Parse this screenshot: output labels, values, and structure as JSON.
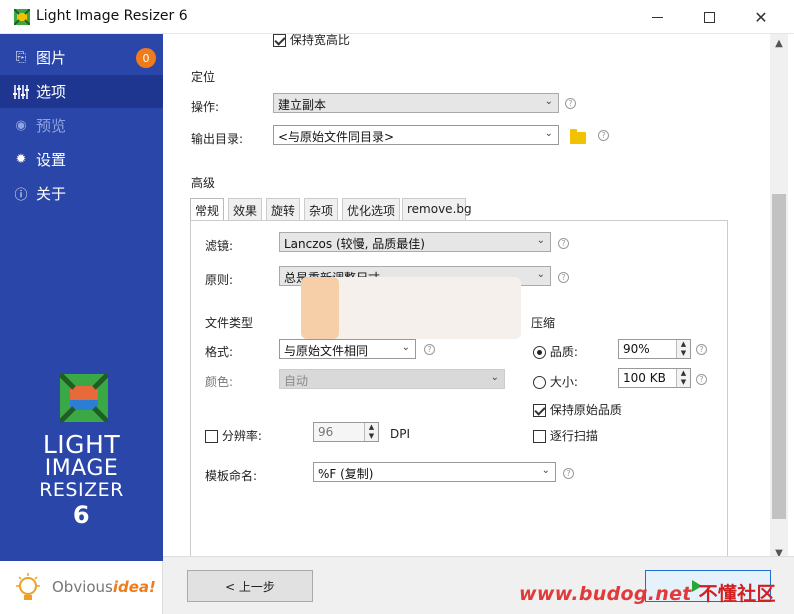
{
  "window": {
    "title": "Light Image Resizer 6"
  },
  "sidebar": {
    "items": [
      {
        "label": "图片",
        "icon": "images-icon",
        "badge": "0"
      },
      {
        "label": "选项",
        "icon": "sliders-icon"
      },
      {
        "label": "预览",
        "icon": "eye-icon"
      },
      {
        "label": "设置",
        "icon": "gear-icon"
      },
      {
        "label": "关于",
        "icon": "info-icon"
      }
    ],
    "logo": {
      "line1": "LIGHT",
      "line2": "IMAGE",
      "line3": "RESIZER",
      "line4": "6"
    },
    "brand": {
      "prefix": "Obvious",
      "suffix": "idea!"
    }
  },
  "options": {
    "keep_ratio_label": "保持宽高比",
    "location_title": "定位",
    "operation_label": "操作:",
    "operation_value": "建立副本",
    "output_dir_label": "输出目录:",
    "output_dir_value": "<与原始文件同目录>",
    "advanced_title": "高级",
    "tabs": [
      "常规",
      "效果",
      "旋转",
      "杂项",
      "优化选项",
      "remove.bg"
    ],
    "filter_label": "滤镜:",
    "filter_value": "Lanczos (较慢, 品质最佳)",
    "rule_label": "原则:",
    "rule_value": "总是重新调整尺寸",
    "file_type_title": "文件类型",
    "compress_title": "压缩",
    "format_label": "格式:",
    "format_value": "与原始文件相同",
    "color_label": "颜色:",
    "color_value": "自动",
    "quality_label": "品质:",
    "quality_value": "90%",
    "size_label": "大小:",
    "size_value": "100 KB",
    "keep_quality_label": "保持原始品质",
    "progressive_label": "逐行扫描",
    "resolution_label": "分辨率:",
    "resolution_value": "96",
    "dpi_label": "DPI",
    "template_label": "模板命名:",
    "template_value": "%F (复制)"
  },
  "footer": {
    "prev_label": "< 上一步",
    "watermark_en": "www.budog.net",
    "watermark_cn": "不懂社区"
  },
  "colors": {
    "sidebar": "#2a46a8",
    "badge": "#ef7c1a",
    "watermark": "#e03a3a"
  }
}
